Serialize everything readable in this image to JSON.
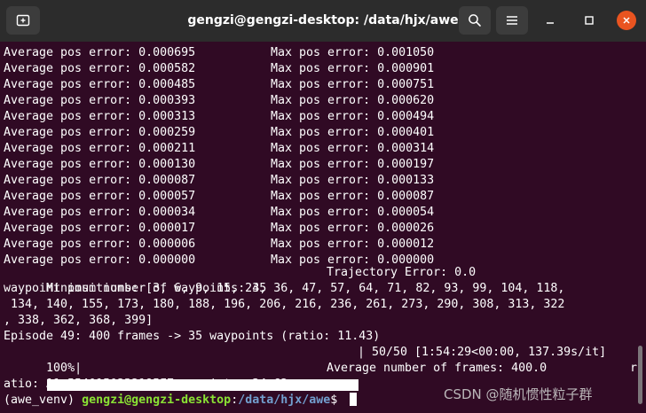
{
  "window": {
    "title": "gengzi@gengzi-desktop: /data/hjx/awe"
  },
  "icons": {
    "new_tab": "new-tab-icon",
    "search": "search-icon",
    "menu": "hamburger-menu-icon",
    "minimize": "minimize-icon",
    "maximize": "maximize-icon",
    "close": "close-icon"
  },
  "colors": {
    "terminal_bg": "#300a24",
    "titlebar_bg": "#2c2c2c",
    "prompt_user": "#8ae234",
    "prompt_path": "#729fcf",
    "close_button": "#e95420"
  },
  "terminal": {
    "error_rows": [
      {
        "avg": "Average pos error: 0.000695",
        "max": "Max pos error: 0.001050"
      },
      {
        "avg": "Average pos error: 0.000582",
        "max": "Max pos error: 0.000901"
      },
      {
        "avg": "Average pos error: 0.000485",
        "max": "Max pos error: 0.000751"
      },
      {
        "avg": "Average pos error: 0.000393",
        "max": "Max pos error: 0.000620"
      },
      {
        "avg": "Average pos error: 0.000313",
        "max": "Max pos error: 0.000494"
      },
      {
        "avg": "Average pos error: 0.000259",
        "max": "Max pos error: 0.000401"
      },
      {
        "avg": "Average pos error: 0.000211",
        "max": "Max pos error: 0.000314"
      },
      {
        "avg": "Average pos error: 0.000130",
        "max": "Max pos error: 0.000197"
      },
      {
        "avg": "Average pos error: 0.000087",
        "max": "Max pos error: 0.000133"
      },
      {
        "avg": "Average pos error: 0.000057",
        "max": "Max pos error: 0.000087"
      },
      {
        "avg": "Average pos error: 0.000034",
        "max": "Max pos error: 0.000054"
      },
      {
        "avg": "Average pos error: 0.000017",
        "max": "Max pos error: 0.000026"
      },
      {
        "avg": "Average pos error: 0.000006",
        "max": "Max pos error: 0.000012"
      },
      {
        "avg": "Average pos error: 0.000000",
        "max": "Max pos error: 0.000000"
      }
    ],
    "min_waypoints": "Minimum number of waypoints: 35",
    "trajectory_error": "Trajectory Error: 0.0",
    "waypoint_lines": [
      "waypoint positions: [3, 6, 9, 15, 24, 36, 47, 57, 64, 71, 82, 93, 99, 104, 118,",
      " 134, 140, 155, 173, 180, 188, 196, 206, 216, 236, 261, 273, 290, 308, 313, 322",
      ", 338, 362, 368, 399]"
    ],
    "episode_line": "Episode 49: 400 frames -> 35 waypoints (ratio: 11.43)",
    "progress": {
      "percent_label": "100%|",
      "fraction": 1.0,
      "suffix": "| 50/50 [1:54:29<00:00, 137.39s/it]"
    },
    "avg_waypoints": "Average number of waypoints: 34.62",
    "avg_frames": "Average number of frames: 400.0",
    "wrap_r": "r",
    "ratio_line": "atio: 11.554015020219527",
    "prompt": {
      "env": "(awe_venv) ",
      "user_host": "gengzi@gengzi-desktop",
      "sep": ":",
      "path": "/data/hjx/awe",
      "symbol": "$ "
    }
  },
  "watermark": "CSDN @随机惯性粒子群"
}
